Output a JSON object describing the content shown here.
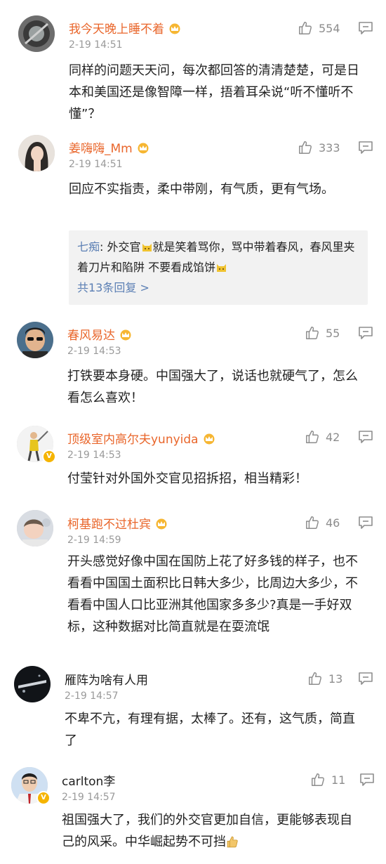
{
  "comments": [
    {
      "name": "我今天晚上睡不着",
      "time": "2-19 14:51",
      "likes": "554",
      "text": "同样的问题天天问，每次都回答的清清楚楚，可是日本和美国还是像智障一样，捂着耳朵说“听不懂听不懂”？"
    },
    {
      "name": "姜嗨嗨_Mm",
      "time": "2-19 14:51",
      "likes": "333",
      "text": "回应不实指责，柔中带刚，有气质，更有气场。",
      "reply": {
        "user": "七痴",
        "text1": ": 外交官",
        "text2": "就是笑着骂你，骂中带着春风，春风里夹着刀片和陷阱 不要看成馅饼",
        "more": "共13条回复 >"
      }
    },
    {
      "name": "春风易达",
      "time": "2-19 14:53",
      "likes": "55",
      "text": "打铁要本身硬。中国强大了，说话也就硬气了，怎么看怎么喜欢！"
    },
    {
      "name": "顶级室内高尔夫yunyida",
      "time": "2-19 14:53",
      "likes": "42",
      "text": "付莹针对外国外交官见招拆招，相当精彩！"
    },
    {
      "name": "柯基跑不过杜宾",
      "time": "2-19 14:59",
      "likes": "46",
      "text": "开头感觉好像中国在国防上花了好多钱的样子，也不看看中国国土面积比日韩大多少，比周边大多少，不看看中国人口比亚洲其他国家多多少?真是一手好双标，这种数据对比简直就是在耍流氓"
    },
    {
      "name": "雁阵为啥有人用",
      "time": "2-19 14:57",
      "likes": "13",
      "text": "不卑不亢，有理有据，太棒了。还有，这气质，简直了"
    },
    {
      "name": "carlton李",
      "time": "2-19 14:57",
      "likes": "11",
      "text": "祖国强大了，我们的外交官更加自信，更能够表现自己的风采。中华崛起势不可挡"
    }
  ],
  "colors": {
    "name": "#e9662b",
    "link": "#5b7fb4",
    "meta": "#9a9a9a"
  }
}
